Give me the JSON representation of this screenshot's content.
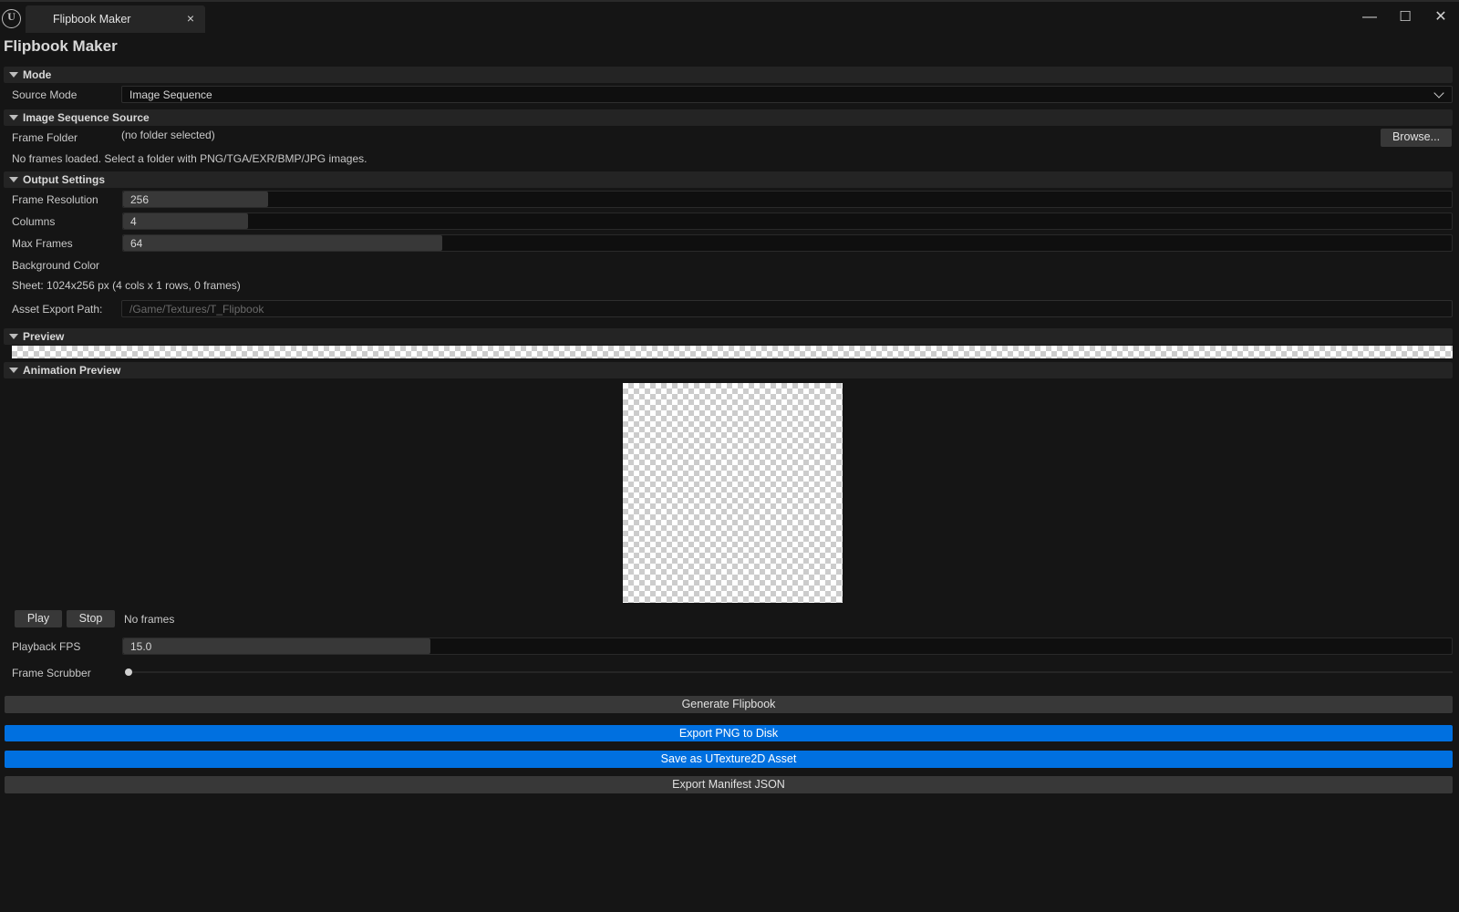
{
  "tab": {
    "title": "Flipbook Maker",
    "close": "×"
  },
  "window_controls": {
    "minimize": "—",
    "maximize": "☐",
    "close": "✕"
  },
  "window_title": "Flipbook Maker",
  "sections": {
    "mode": "Mode",
    "image_sequence_source": "Image Sequence Source",
    "output_settings": "Output Settings",
    "preview": "Preview",
    "animation_preview": "Animation Preview"
  },
  "mode": {
    "source_mode_label": "Source Mode",
    "source_mode_value": "Image Sequence"
  },
  "source": {
    "frame_folder_label": "Frame Folder",
    "frame_folder_value": "(no folder selected)",
    "browse_label": "Browse...",
    "status": "No frames loaded. Select a folder with PNG/TGA/EXR/BMP/JPG images."
  },
  "output": {
    "frame_resolution_label": "Frame Resolution",
    "frame_resolution_value": "256",
    "frame_resolution_fill": 0.109,
    "columns_label": "Columns",
    "columns_value": "4",
    "columns_fill": 0.094,
    "max_frames_label": "Max Frames",
    "max_frames_value": "64",
    "max_frames_fill": 0.24,
    "background_color_label": "Background Color",
    "sheet_info": "Sheet: 1024x256 px (4 cols x 1 rows, 0 frames)",
    "asset_path_label": "Asset Export Path:",
    "asset_path_placeholder": "/Game/Textures/T_Flipbook"
  },
  "animation": {
    "play_label": "Play",
    "stop_label": "Stop",
    "status": "No frames",
    "fps_label": "Playback FPS",
    "fps_value": "15.0",
    "fps_fill": 0.231,
    "scrubber_label": "Frame Scrubber",
    "scrubber_position": 0
  },
  "actions": {
    "generate": "Generate Flipbook",
    "export_png": "Export PNG to Disk",
    "save_asset": "Save as UTexture2D Asset",
    "export_manifest": "Export Manifest JSON"
  },
  "colors": {
    "background": "#151515",
    "section": "#242424",
    "accent_blue": "#0070e0",
    "button": "#383838"
  }
}
